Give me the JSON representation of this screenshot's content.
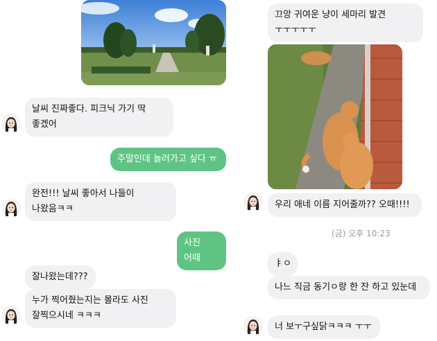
{
  "left_chat": {
    "msg_weather": "날씨 진짜좋다. 피크닉 가기 딱 좋겠어",
    "msg_weekend": "주말인데 놀러가고 싶다 ㅠ",
    "msg_outing": "완전!!! 날씨 좋아서 나들이 나왔음ㅋㅋ",
    "msg_photo": "사진 어때",
    "msg_well": "잘나왔는데???",
    "msg_who": "누가 찍어줬는지는 몰라도 사진 잘찍으시네 ㅋㅋㅋ"
  },
  "right_chat": {
    "msg_cats": "끄앙 귀여운 냥이 세마리 발견 ㅜㅜㅜㅜㅜ",
    "msg_name": "우리 애네 이름 지어줄까?? 오때!!!!",
    "timestamp": "(금) 오후 10:23",
    "msg_ya": "ㅑㅇ",
    "msg_drink": "나느 직금 동기ㅇ랑 한 잔 하고 있눈데",
    "msg_miss": "너 보ㅜ구싶닭ㅋㅋㅋ ㅜㅜ"
  },
  "colors": {
    "incoming_bubble": "#f1f1f3",
    "outgoing_bubble": "#5fc483",
    "timestamp_text": "#999999"
  },
  "images": {
    "park_photo": "park-garden-photo",
    "cat_photo": "orange-cats-photo"
  }
}
